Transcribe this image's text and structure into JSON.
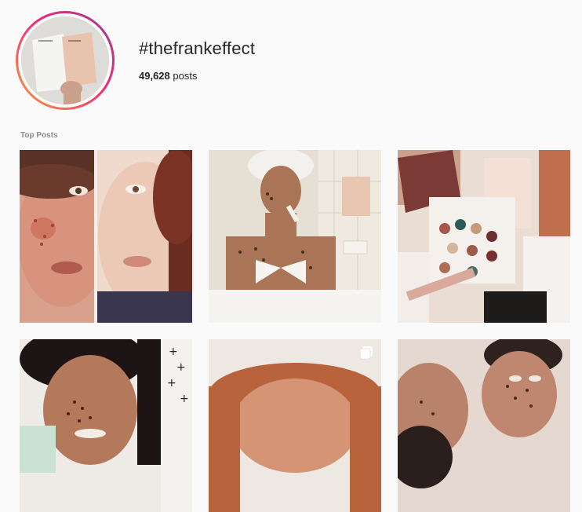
{
  "header": {
    "hashtag": "#thefrankeffect",
    "post_count": "49,628",
    "post_count_suffix": " posts"
  },
  "sections": {
    "top_posts_label": "Top Posts"
  },
  "posts": [
    {
      "name": "post-1",
      "icon": "before-after-acne-photo"
    },
    {
      "name": "post-2",
      "icon": "bath-scrub-photo"
    },
    {
      "name": "post-3",
      "icon": "makeup-products-photo"
    },
    {
      "name": "post-4",
      "icon": "coffee-scrub-face-photo"
    },
    {
      "name": "post-5",
      "icon": "red-hair-photo",
      "badge": "multi-photo-icon"
    },
    {
      "name": "post-6",
      "icon": "couple-scrub-photo"
    }
  ],
  "colors": {
    "ring_start": "#f9a13a",
    "ring_end": "#c13584",
    "background": "#fafafa",
    "muted_text": "#8e8e8e"
  }
}
